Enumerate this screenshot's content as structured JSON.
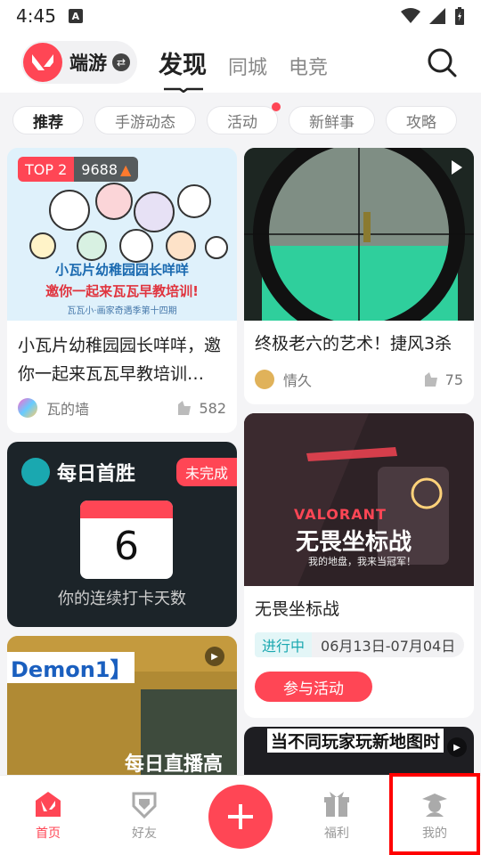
{
  "status_bar": {
    "time": "4:45",
    "badge": "A"
  },
  "brand": {
    "label": "端游"
  },
  "main_tabs": [
    {
      "label": "发现"
    },
    {
      "label": "同城"
    },
    {
      "label": "电竞"
    }
  ],
  "chips": [
    {
      "label": "推荐"
    },
    {
      "label": "手游动态"
    },
    {
      "label": "活动"
    },
    {
      "label": "新鲜事"
    },
    {
      "label": "攻略"
    }
  ],
  "feed": {
    "card1": {
      "rank": "TOP 2",
      "heat": "9688",
      "poster_line1": "小瓦片幼稚园园长咩咩",
      "poster_line2": "邀你一起来瓦瓦早教培训!",
      "poster_line3": "瓦瓦小·画家奇遇季第十四期",
      "title": "小瓦片幼稚园园长咩咩，邀你一起来瓦瓦早教培训…",
      "author": "瓦的墙",
      "likes": "582"
    },
    "card2": {
      "title": "终极老六的艺术！捷风3杀",
      "author": "情久",
      "likes": "75"
    },
    "card3": {
      "brand": "每日首胜",
      "status": "未完成",
      "days": "6",
      "caption": "你的连续打卡天数"
    },
    "card4": {
      "poster_brand": "VALORANT",
      "poster_title": "无畏坐标战",
      "poster_sub": "我的地盘，我来当冠军！",
      "title": "无畏坐标战",
      "status": "进行中",
      "dates": "06月13日-07月04日",
      "join": "参与活动"
    },
    "card5": {
      "overlay1": "Demon1】",
      "overlay2": "每日直播高"
    },
    "card6": {
      "overlay": "当不同玩家玩新地图时"
    }
  },
  "tabbar": {
    "home": "首页",
    "friends": "好友",
    "welfare": "福利",
    "me": "我的"
  },
  "colors": {
    "accent": "#ff4655",
    "teal": "#1aa8b0"
  }
}
